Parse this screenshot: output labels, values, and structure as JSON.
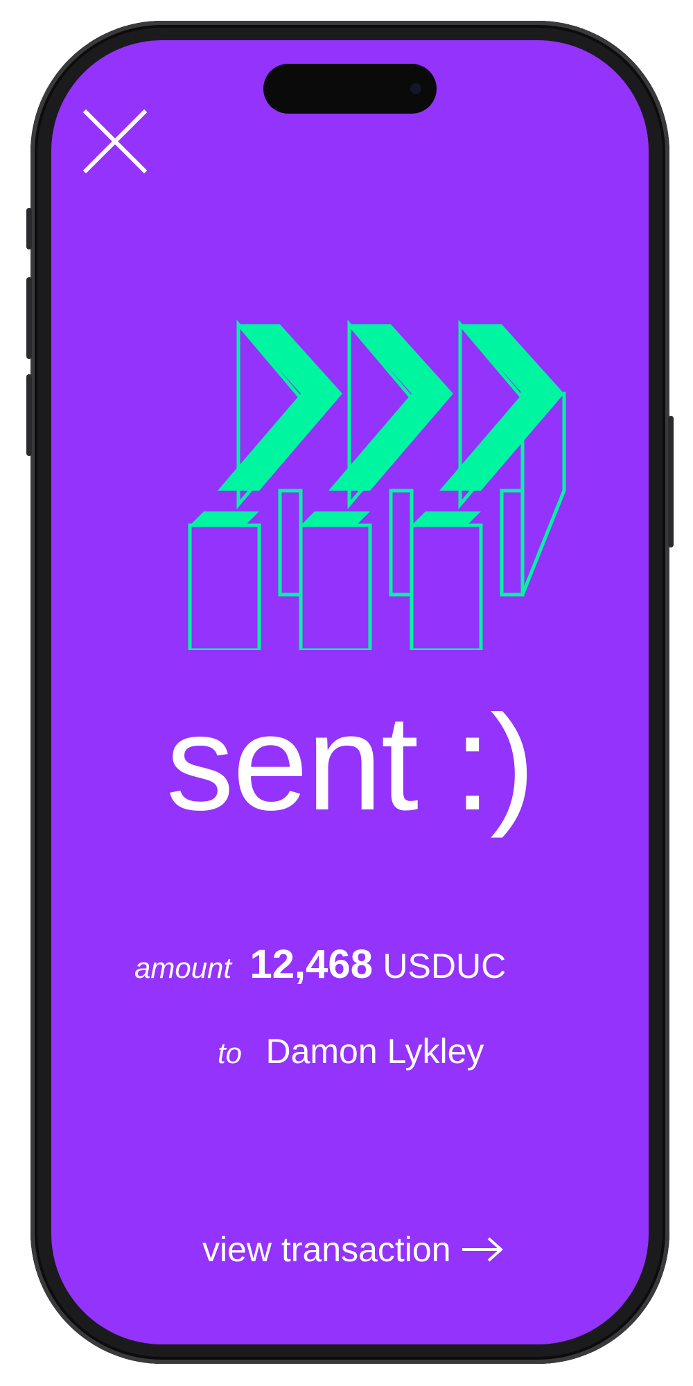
{
  "colors": {
    "background": "#9333fb",
    "accent": "#00f5a0",
    "text": "#ffffff"
  },
  "icons": {
    "close": "close-icon",
    "hero": "forward-arrows-illustration",
    "cta_arrow": "arrow-right-icon"
  },
  "headline": "sent :)",
  "details": {
    "amount_label": "amount",
    "amount_value": "12,468",
    "amount_unit": "USDUC",
    "recipient_label": "to",
    "recipient_name": "Damon Lykley"
  },
  "cta": {
    "label": "view transaction"
  }
}
